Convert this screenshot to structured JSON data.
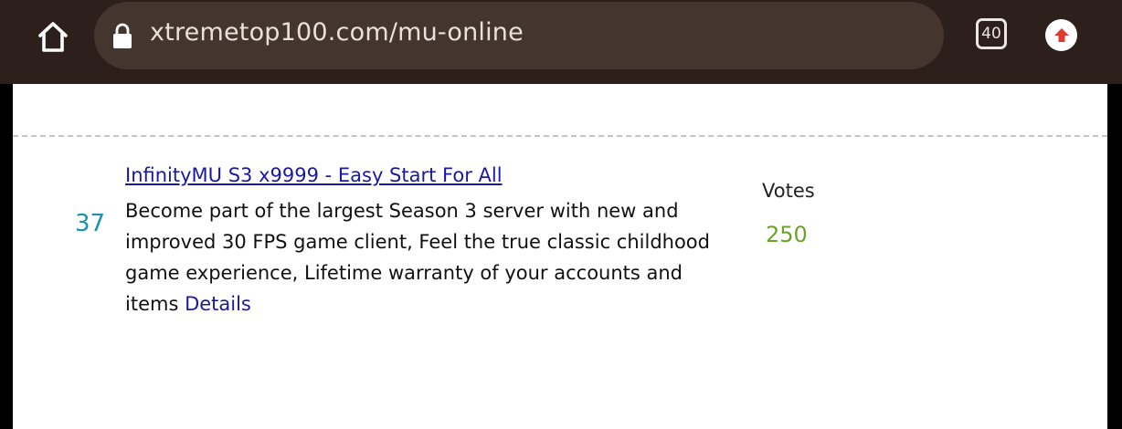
{
  "browser": {
    "url": "xtremetop100.com/mu-online",
    "tab_count": "40",
    "colors": {
      "toolbar": "#2d201c",
      "url_bar": "#45352f",
      "update_badge": "#e03a2f"
    },
    "icons": {
      "home": "home-icon",
      "lock": "lock-icon",
      "tabs": "tab-count-icon",
      "update": "arrow-up-icon"
    }
  },
  "listing": {
    "rank": "37",
    "title": "InfinityMU S3 x9999 - Easy Start For All",
    "description": "Become part of the largest Season 3 server with new and improved 30 FPS game client, Feel the true classic childhood game experience, Lifetime warranty of your accounts and items",
    "details_label": "Details",
    "votes_label": "Votes",
    "votes_count": "250",
    "colors": {
      "rank": "#1793ad",
      "link": "#1a1aa0",
      "votes": "#6aa32a"
    }
  }
}
